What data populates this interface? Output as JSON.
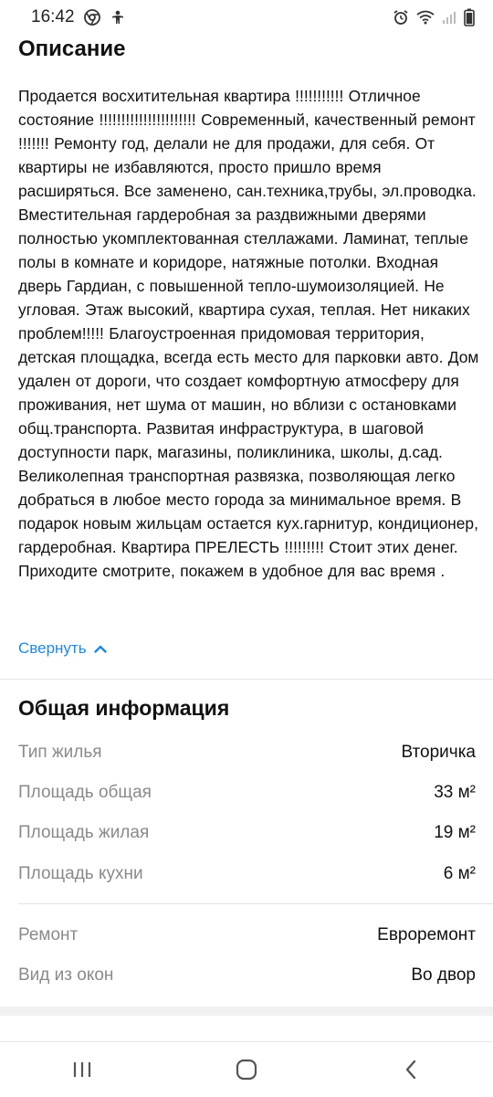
{
  "status_bar": {
    "time": "16:42",
    "left_icons": [
      "chrome-icon",
      "accessibility-icon"
    ],
    "right_icons": [
      "alarm-icon",
      "wifi-icon",
      "signal-icon",
      "battery-icon"
    ]
  },
  "description": {
    "title": "Описание",
    "text": "Продается восхитительная квартира !!!!!!!!!!! Отличное состояние !!!!!!!!!!!!!!!!!!!!!! Современный, качественный ремонт !!!!!!! Ремонту год, делали не для продажи, для себя. От квартиры не избавляются, просто пришло время расширяться. Все заменено, сан.техника,трубы, эл.проводка. Вместительная гардеробная за раздвижными дверями полностью укомплектованная стеллажами. Ламинат, теплые полы в комнате и коридоре, натяжные потолки. Входная дверь Гардиан, с повышенной тепло-шумоизоляцией. Не угловая. Этаж высокий, квартира сухая, теплая. Нет никаких проблем!!!!! Благоустроенная придомовая территория, детская площадка, всегда есть место для парковки авто. Дом удален от дороги, что создает комфортную атмосферу для проживания, нет шума от машин, но вблизи с остановками общ.транспорта. Развитая инфраструктура, в шаговой доступности парк, магазины, поликлиника, школы, д.сад. Великолепная транспортная развязка, позволяющая легко добраться в любое место города за минимальное время. В подарок новым жильцам остается кух.гарнитур, кондиционер, гардеробная. Квартира ПРЕЛЕСТЬ !!!!!!!!! Стоит этих денег. Приходите смотрите, покажем в удобное для вас время .",
    "collapse_label": "Свернуть"
  },
  "general_info": {
    "title": "Общая информация",
    "rows": [
      {
        "label": "Тип жилья",
        "value": "Вторичка"
      },
      {
        "label": "Площадь общая",
        "value": "33 м²"
      },
      {
        "label": "Площадь жилая",
        "value": "19 м²"
      },
      {
        "label": "Площадь кухни",
        "value": "6 м²"
      },
      {
        "label": "Ремонт",
        "value": "Евроремонт"
      },
      {
        "label": "Вид из окон",
        "value": "Во двор"
      }
    ]
  },
  "nav_bar": {
    "buttons": [
      "recent-apps-icon",
      "home-icon",
      "back-icon"
    ]
  },
  "colors": {
    "link": "#1e88e5",
    "label_gray": "#8a8a8a",
    "divider": "#e3e3e3"
  }
}
